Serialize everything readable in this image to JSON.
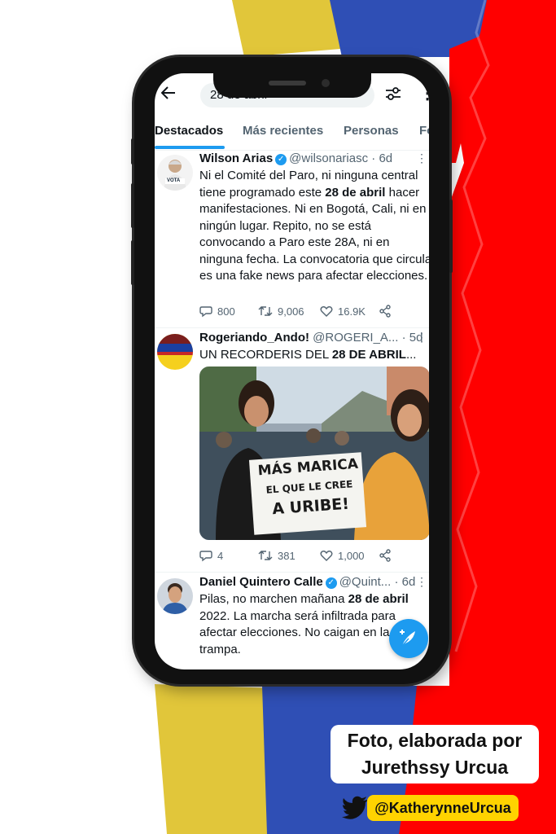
{
  "search": {
    "query": "28 de abril"
  },
  "tabs": [
    "Destacados",
    "Más recientes",
    "Personas",
    "Fo"
  ],
  "tweets": [
    {
      "name": "Wilson Arias",
      "handle": "@wilsonariasc",
      "time": "6d",
      "avatar_caption": "VOTA",
      "text_parts": [
        "Ni el Comité del Paro, ni ninguna central tiene programado este ",
        "28 de abril",
        " hacer manifestaciones. Ni en Bogotá, Cali, ni en ningún lugar. Repito, no se está convocando a Paro este 28A, ni en ninguna fecha. La convocatoria que circula es una fake news para afectar elecciones."
      ],
      "replies": "800",
      "retweets": "9,006",
      "likes": "16.9K"
    },
    {
      "name": "Rogeriando_Ando!",
      "handle": "@ROGERI_A...",
      "time": "5d",
      "text_parts": [
        "UN RECORDERIS DEL ",
        "28 DE ABRIL",
        "..."
      ],
      "sign_lines": [
        "MÁS MARICA",
        "EL QUE LE CREE",
        "A URIBE!"
      ],
      "replies": "4",
      "retweets": "381",
      "likes": "1,000"
    },
    {
      "name": "Daniel Quintero Calle",
      "handle": "@Quint...",
      "time": "6d",
      "text_parts": [
        "Pilas, no marchen mañana ",
        "28 de abril",
        " 2022. La marcha será infiltrada para afectar elecciones. No caigan en la trampa."
      ]
    }
  ],
  "credit": {
    "line1": "Foto, elaborada por",
    "line2": "Jurethssy Urcua",
    "twitter_handle": "@KatherynneUrcua"
  },
  "colors": {
    "accent": "#1d9bf0",
    "flag_yellow": "#e1c63a",
    "flag_blue": "#2f4fb5",
    "flag_red": "#ff0000"
  },
  "icons": [
    "back-arrow-icon",
    "filter-icon",
    "more-icon",
    "verified-icon",
    "reply-icon",
    "retweet-icon",
    "like-icon",
    "share-icon",
    "compose-icon",
    "twitter-bird-icon"
  ]
}
